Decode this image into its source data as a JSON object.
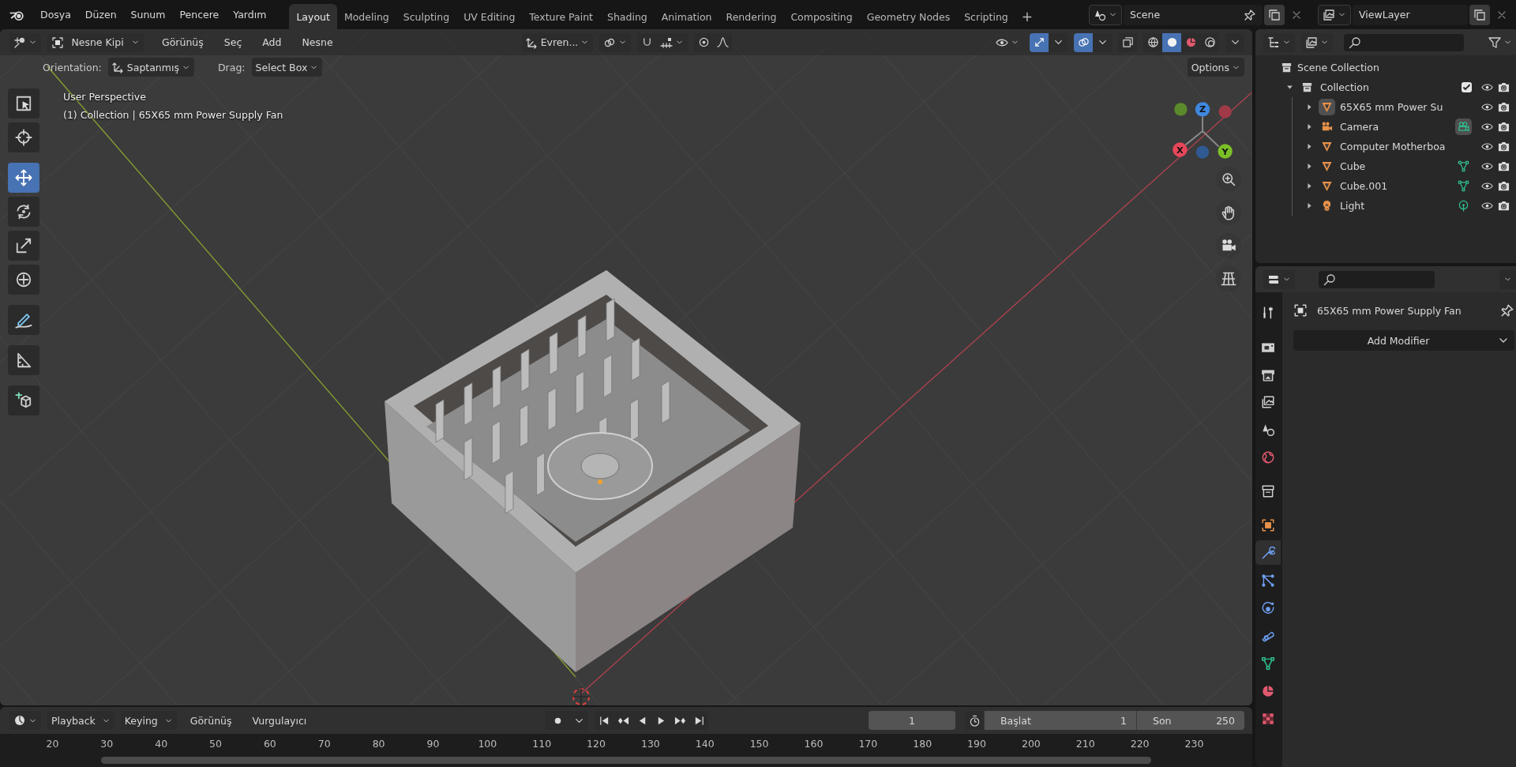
{
  "topbar": {
    "menus": [
      "Dosya",
      "Düzen",
      "Sunum",
      "Pencere",
      "Yardım"
    ],
    "workspaces": [
      {
        "label": "Layout",
        "selected": true
      },
      {
        "label": "Modeling",
        "selected": false
      },
      {
        "label": "Sculpting",
        "selected": false
      },
      {
        "label": "UV Editing",
        "selected": false
      },
      {
        "label": "Texture Paint",
        "selected": false
      },
      {
        "label": "Shading",
        "selected": false
      },
      {
        "label": "Animation",
        "selected": false
      },
      {
        "label": "Rendering",
        "selected": false
      },
      {
        "label": "Compositing",
        "selected": false
      },
      {
        "label": "Geometry Nodes",
        "selected": false
      },
      {
        "label": "Scripting",
        "selected": false
      }
    ],
    "add_workspace": "+",
    "scene": "Scene",
    "view_layer": "ViewLayer"
  },
  "viewport": {
    "header": {
      "mode": "Nesne Kipi",
      "menus": [
        "Görünüş",
        "Seç",
        "Add",
        "Nesne"
      ],
      "orientation": "Evren...",
      "toggles": [
        {
          "kind": "snap",
          "on": false
        },
        {
          "kind": "proportional",
          "on": false
        },
        {
          "kind": "gizmo",
          "on": true
        },
        {
          "kind": "overlay",
          "on": true
        },
        {
          "kind": "xray",
          "on": false
        }
      ],
      "shading": [
        {
          "kind": "wireframe",
          "selected": false
        },
        {
          "kind": "solid",
          "selected": true
        },
        {
          "kind": "material",
          "selected": false
        },
        {
          "kind": "rendered",
          "selected": false
        }
      ]
    },
    "tool_settings": {
      "orientation_label": "Orientation:",
      "orientation": "Saptanmış",
      "drag_label": "Drag:",
      "drag": "Select Box",
      "options": "Options"
    },
    "tools": [
      {
        "kind": "select",
        "selected": false
      },
      {
        "kind": "cursor",
        "selected": false
      },
      {
        "kind": "move",
        "selected": true
      },
      {
        "kind": "rotate",
        "selected": false
      },
      {
        "kind": "scale",
        "selected": false
      },
      {
        "kind": "transform",
        "selected": false
      },
      {
        "kind": "annotate",
        "selected": false
      },
      {
        "kind": "measure",
        "selected": false
      },
      {
        "kind": "add_cube",
        "selected": false
      }
    ],
    "overlay": {
      "perspective": "User Perspective",
      "context": "(1) Collection | 65X65 mm Power Supply Fan"
    },
    "gizmo": {
      "x": "X",
      "y": "Y",
      "z": "Z"
    }
  },
  "outliner": {
    "root": "Scene Collection",
    "collection": {
      "name": "Collection",
      "expanded": true,
      "checked": true,
      "children": [
        {
          "name": "65X65 mm Power Su",
          "kind": "mesh",
          "selected": true,
          "expanded": false
        },
        {
          "name": "Camera",
          "kind": "camera",
          "data": {
            "kind": "camera",
            "active": true
          },
          "selected": false,
          "expanded": false
        },
        {
          "name": "Computer Motherboa",
          "kind": "mesh",
          "selected": false,
          "expanded": false
        },
        {
          "name": "Cube",
          "kind": "mesh",
          "data": {
            "kind": "mesh",
            "active": false
          },
          "selected": false,
          "expanded": false
        },
        {
          "name": "Cube.001",
          "kind": "mesh",
          "data": {
            "kind": "mesh",
            "active": false
          },
          "selected": false,
          "expanded": false
        },
        {
          "name": "Light",
          "kind": "light",
          "data": {
            "kind": "light",
            "active": false
          },
          "selected": false,
          "expanded": false
        }
      ]
    }
  },
  "properties": {
    "tabs": [
      {
        "kind": "tool",
        "selected": false
      },
      {
        "kind": "render",
        "selected": false
      },
      {
        "kind": "output",
        "selected": false
      },
      {
        "kind": "view_layer",
        "selected": false
      },
      {
        "kind": "scene",
        "selected": false
      },
      {
        "kind": "world",
        "selected": false
      },
      {
        "kind": "collection",
        "selected": false
      },
      {
        "kind": "object",
        "selected": false
      },
      {
        "kind": "modifiers",
        "selected": true
      },
      {
        "kind": "particles",
        "selected": false
      },
      {
        "kind": "physics",
        "selected": false
      },
      {
        "kind": "constraints",
        "selected": false
      },
      {
        "kind": "data",
        "selected": false
      },
      {
        "kind": "material",
        "selected": false
      },
      {
        "kind": "texture",
        "selected": false
      }
    ],
    "object_name": "65X65 mm Power Supply Fan",
    "add_modifier": "Add Modifier"
  },
  "timeline": {
    "menus": [
      {
        "label": "Playback",
        "kind": "dropdown"
      },
      {
        "label": "Keying",
        "kind": "dropdown"
      },
      {
        "label": "Görünüş",
        "kind": "menu"
      },
      {
        "label": "Vurgulayıcı",
        "kind": "menu"
      }
    ],
    "auto_key": false,
    "current_frame": "1",
    "start_label": "Başlat",
    "start": "1",
    "end_label": "Son",
    "end": "250",
    "ruler": [
      "20",
      "30",
      "40",
      "50",
      "60",
      "70",
      "80",
      "90",
      "100",
      "110",
      "120",
      "130",
      "140",
      "150",
      "160",
      "170",
      "180",
      "190",
      "200",
      "210",
      "220",
      "230"
    ]
  }
}
